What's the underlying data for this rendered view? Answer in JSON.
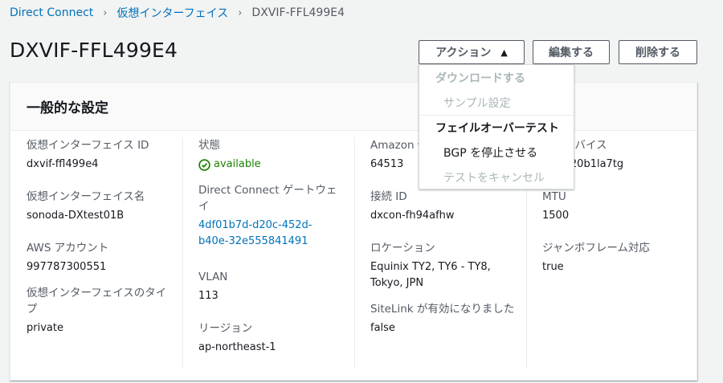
{
  "breadcrumb": {
    "items": [
      "Direct Connect",
      "仮想インターフェイス"
    ],
    "current": "DXVIF-FFL499E4"
  },
  "page": {
    "title": "DXVIF-FFL499E4"
  },
  "buttons": {
    "actions": "アクション",
    "edit": "編集する",
    "delete": "削除する"
  },
  "panel": {
    "title": "一般的な設定"
  },
  "fields": {
    "vif_id": {
      "label": "仮想インターフェイス ID",
      "value": "dxvif-ffl499e4"
    },
    "vif_name": {
      "label": "仮想インターフェイス名",
      "value": "sonoda-DXtest01B"
    },
    "aws_account": {
      "label": "AWS アカウント",
      "value": "997787300551"
    },
    "vif_type": {
      "label": "仮想インターフェイスのタイプ",
      "value": "private"
    },
    "state": {
      "label": "状態",
      "value": "available"
    },
    "dx_gateway": {
      "label": "Direct Connect ゲートウェイ",
      "value": "4df01b7d-d20c-452d-b40e-32e555841491"
    },
    "vlan": {
      "label": "VLAN",
      "value": "113"
    },
    "region": {
      "label": "リージョン",
      "value": "ap-northeast-1"
    },
    "amazon_asn": {
      "label": "Amazon 側",
      "value": "64513"
    },
    "connection_id": {
      "label": "接続 ID",
      "value": "dxcon-fh94afhw"
    },
    "location": {
      "label": "ロケーション",
      "value": "Equinix TY2, TY6 - TY8, Tokyo, JPN"
    },
    "sitelink": {
      "label": "SiteLink が有効になりました",
      "value": "false"
    },
    "logical_device": {
      "label": "論理デバイス",
      "value": "-2lwv20b1la7tg"
    },
    "mtu": {
      "label": "MTU",
      "value": "1500"
    },
    "jumbo": {
      "label": "ジャンボフレーム対応",
      "value": "true"
    }
  },
  "dropdown": {
    "download_header": "ダウンロードする",
    "sample_config": "サンプル設定",
    "failover_header": "フェイルオーバーテスト",
    "stop_bgp": "BGP を停止させる",
    "cancel_test": "テストをキャンセル"
  },
  "colors": {
    "link": "#0073bb",
    "status_available": "#1d8102"
  }
}
